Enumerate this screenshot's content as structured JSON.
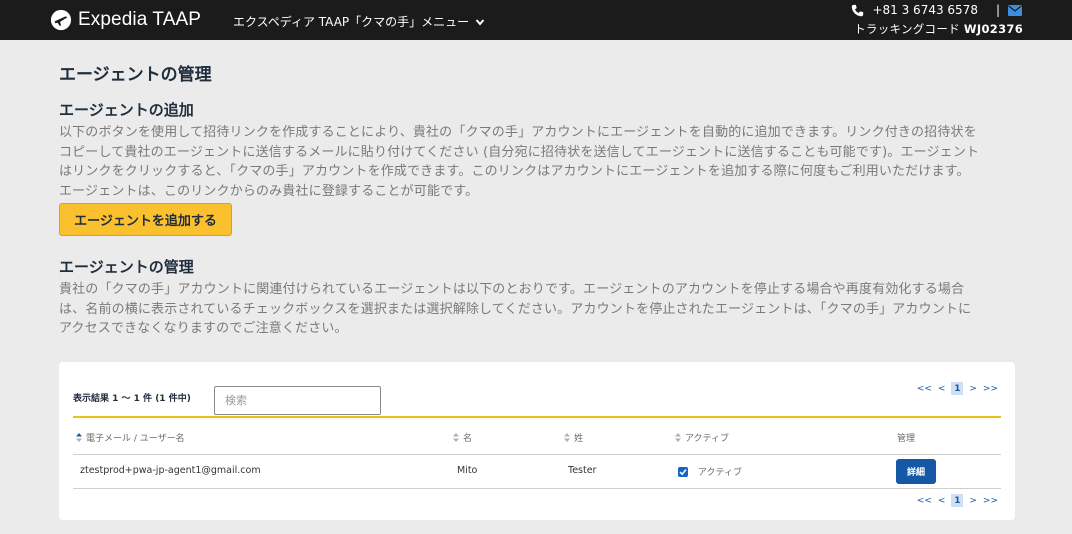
{
  "header": {
    "logo_text": "Expedia TAAP",
    "menu_label": "エクスペディア TAAP「クマの手」メニュー",
    "phone": "+81 3 6743 6578",
    "separator": "|",
    "tracking_label": "トラッキングコード",
    "tracking_code": "WJ02376"
  },
  "page": {
    "title": "エージェントの管理",
    "add_section": {
      "heading": "エージェントの追加",
      "lines": [
        "以下のボタンを使用して招待リンクを作成することにより、貴社の「クマの手」アカウントにエージェントを自動的に追加できます。リンク付きの招待状を",
        "コピーして貴社のエージェントに送信するメールに貼り付けてください (自分宛に招待状を送信してエージェントに送信することも可能です)。エージェント",
        "はリンクをクリックすると、「クマの手」アカウントを作成できます。このリンクはアカウントにエージェントを追加する際に何度もご利用いただけます。",
        "エージェントは、このリンクからのみ貴社に登録することが可能です。"
      ],
      "button_label": "エージェントを追加する"
    },
    "manage_section": {
      "heading": "エージェントの管理",
      "lines": [
        "貴社の「クマの手」アカウントに関連付けられているエージェントは以下のとおりです。エージェントのアカウントを停止する場合や再度有効化する場合",
        "は、名前の横に表示されているチェックボックスを選択または選択解除してください。アカウントを停止されたエージェントは、「クマの手」アカウントに",
        "アクセスできなくなりますのでご注意ください。"
      ]
    }
  },
  "table": {
    "results_text": "表示結果 1 ～ 1 件 (1 件中)",
    "search_placeholder": "検索",
    "pager": {
      "first": "<<",
      "prev": "<",
      "current": "1",
      "next": ">",
      "last": ">>"
    },
    "columns": {
      "email": "電子メール / ユーザー名",
      "first_name": "名",
      "last_name": "姓",
      "active": "アクティブ",
      "manage": "管理"
    },
    "rows": [
      {
        "email": "ztestprod+pwa-jp-agent1@gmail.com",
        "first_name": "Mito",
        "last_name": "Tester",
        "active_checked": true,
        "active_label": "アクティブ",
        "detail_label": "詳細"
      }
    ]
  },
  "colors": {
    "topbar": "#1b1b1b",
    "accent_button": "#fbc02d",
    "primary_blue": "#1559a6",
    "divider_yellow": "#e8c21a"
  }
}
